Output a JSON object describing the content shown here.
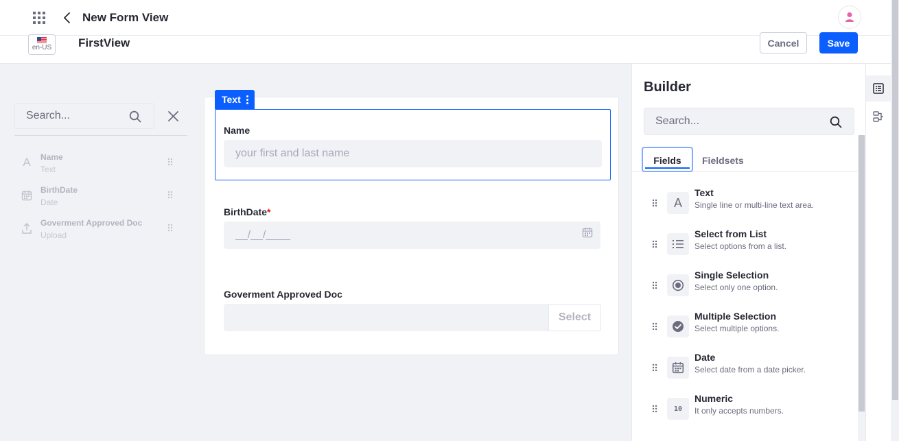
{
  "header": {
    "title": "New Form View"
  },
  "subbar": {
    "locale": "en-US",
    "view_name": "FirstView",
    "cancel_label": "Cancel",
    "save_label": "Save"
  },
  "left_panel": {
    "search_placeholder": "Search...",
    "items": [
      {
        "label": "Name",
        "type": "Text",
        "icon": "text-icon"
      },
      {
        "label": "BirthDate",
        "type": "Date",
        "icon": "calendar-icon"
      },
      {
        "label": "Goverment Approved Doc",
        "type": "Upload",
        "icon": "upload-icon"
      }
    ]
  },
  "form": {
    "selected_tag": "Text",
    "fields": [
      {
        "label": "Name",
        "placeholder": "your first and last name"
      },
      {
        "label": "BirthDate",
        "required_mark": "*",
        "placeholder": "__/__/____"
      },
      {
        "label": "Goverment Approved Doc",
        "button": "Select"
      }
    ]
  },
  "builder": {
    "title": "Builder",
    "search_placeholder": "Search...",
    "tabs": [
      {
        "label": "Fields",
        "active": true
      },
      {
        "label": "Fieldsets",
        "active": false
      }
    ],
    "items": [
      {
        "name": "Text",
        "description": "Single line or multi-line text area.",
        "icon": "text-icon"
      },
      {
        "name": "Select from List",
        "description": "Select options from a list.",
        "icon": "list-icon"
      },
      {
        "name": "Single Selection",
        "description": "Select only one option.",
        "icon": "radio-icon"
      },
      {
        "name": "Multiple Selection",
        "description": "Select multiple options.",
        "icon": "check-circle-icon"
      },
      {
        "name": "Date",
        "description": "Select date from a date picker.",
        "icon": "calendar-icon"
      },
      {
        "name": "Numeric",
        "description": "It only accepts numbers.",
        "icon": "numeric-icon",
        "glyph": "10"
      }
    ]
  },
  "colors": {
    "primary": "#0b5fff",
    "required": "#da1414",
    "avatar": "#e665a8"
  }
}
